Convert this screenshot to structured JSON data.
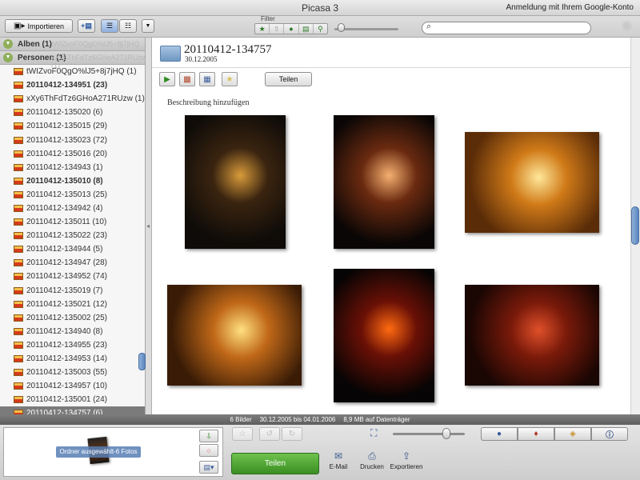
{
  "app": {
    "title": "Picasa 3",
    "signin": "Anmeldung mit Ihrem Google-Konto"
  },
  "toolbar": {
    "import_label": "Importieren",
    "filter_label": "Filter",
    "filter_icons": [
      "star-icon",
      "upload-icon",
      "person-icon",
      "movie-icon",
      "geotag-icon"
    ],
    "search_placeholder": ""
  },
  "sidebar": {
    "categories": [
      {
        "label": "Alben (1)",
        "ghost": "tWIZvoF0QgO%lJ5+8j7jHQ (1)"
      },
      {
        "label": "Personen (1)",
        "ghost": "xXy6ThFdTz6GHoA271RUzw (1)"
      }
    ],
    "folders": [
      {
        "label": "tWIZvoF0QgO%lJ5+8j7jHQ (1)",
        "bold": false
      },
      {
        "label": "20110412-134951 (23)",
        "bold": true
      },
      {
        "label": "xXy6ThFdTz6GHoA271RUzw (1)",
        "bold": false
      },
      {
        "label": "20110412-135020 (6)",
        "bold": false
      },
      {
        "label": "20110412-135015 (29)",
        "bold": false
      },
      {
        "label": "20110412-135023 (72)",
        "bold": false
      },
      {
        "label": "20110412-135016 (20)",
        "bold": false
      },
      {
        "label": "20110412-134943 (1)",
        "bold": false
      },
      {
        "label": "20110412-135010 (8)",
        "bold": true
      },
      {
        "label": "20110412-135013 (25)",
        "bold": false
      },
      {
        "label": "20110412-134942 (4)",
        "bold": false
      },
      {
        "label": "20110412-135011 (10)",
        "bold": false
      },
      {
        "label": "20110412-135022 (23)",
        "bold": false
      },
      {
        "label": "20110412-134944 (5)",
        "bold": false
      },
      {
        "label": "20110412-134947 (28)",
        "bold": false
      },
      {
        "label": "20110412-134952 (74)",
        "bold": false
      },
      {
        "label": "20110412-135019 (7)",
        "bold": false
      },
      {
        "label": "20110412-135021 (12)",
        "bold": false
      },
      {
        "label": "20110412-135002 (25)",
        "bold": false
      },
      {
        "label": "20110412-134940 (8)",
        "bold": false
      },
      {
        "label": "20110412-134955 (23)",
        "bold": false
      },
      {
        "label": "20110412-134953 (14)",
        "bold": false
      },
      {
        "label": "20110412-135003 (55)",
        "bold": false
      },
      {
        "label": "20110412-134957 (10)",
        "bold": false
      },
      {
        "label": "20110412-135001 (24)",
        "bold": false
      },
      {
        "label": "20110412-134757 (6)",
        "bold": false,
        "selected": true
      }
    ]
  },
  "main": {
    "folder_title": "20110412-134757",
    "folder_date": "30.12.2005",
    "share_label": "Teilen",
    "description_placeholder": "Beschreibung hinzufügen",
    "photos": [
      {
        "name": "tealight-candles-row",
        "colors": [
          "#0e0b08",
          "#3a2410",
          "#d89b3a"
        ]
      },
      {
        "name": "salt-lamp",
        "colors": [
          "#0a0605",
          "#6a2a10",
          "#f4b070"
        ]
      },
      {
        "name": "two-candles-orange-wall",
        "colors": [
          "#5a2c08",
          "#d07a18",
          "#ffe89a"
        ]
      },
      {
        "name": "two-candles-dim",
        "colors": [
          "#3a1c06",
          "#c06818",
          "#ffe080"
        ]
      },
      {
        "name": "lava-lamp",
        "colors": [
          "#060404",
          "#6a1006",
          "#ff6a10"
        ]
      },
      {
        "name": "hand-red-light",
        "colors": [
          "#1a0603",
          "#7a1a0a",
          "#e0502a"
        ]
      }
    ]
  },
  "status": {
    "count": "6 Bilder",
    "range": "30.12.2005 bis 04.01.2006",
    "size": "8,9 MB auf Datenträger"
  },
  "tray": {
    "label": "Ordner ausgewählt-6 Fotos"
  },
  "actions": {
    "share_label": "Teilen",
    "email_label": "E-Mail",
    "print_label": "Drucken",
    "export_label": "Exportieren"
  }
}
